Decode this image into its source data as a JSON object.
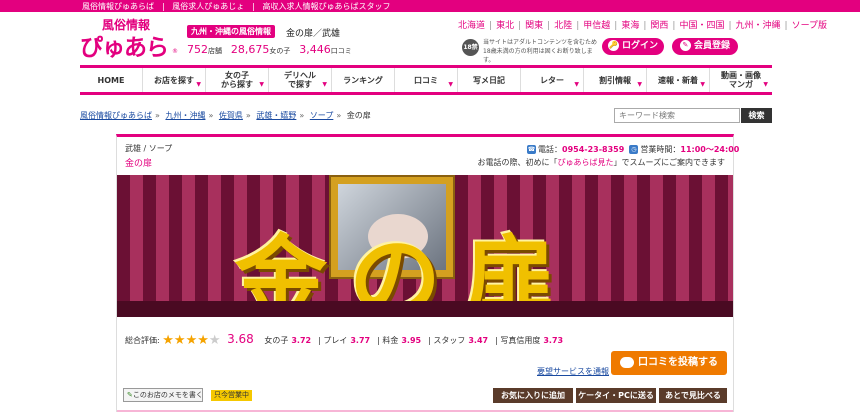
{
  "topbar": {
    "links": [
      "風俗情報ぴゅあらば",
      "風俗求人ぴゅあじょ",
      "高収入求人情報ぴゅあらばスタッフ"
    ]
  },
  "logo": {
    "small": "風俗情報",
    "big": "ぴゅあらば",
    "reg": "®"
  },
  "header": {
    "region_badge": "九州・沖縄の風俗情報",
    "title": "金の扉／武雄",
    "stats": [
      {
        "num": "752",
        "unit": "店舗"
      },
      {
        "num": "28,675",
        "unit": "女の子"
      },
      {
        "num": "3,446",
        "unit": "口コミ"
      }
    ],
    "regions": [
      "北海道",
      "東北",
      "関東",
      "北陸",
      "甲信越",
      "東海",
      "関西",
      "中国・四国",
      "九州・沖縄",
      "ソープ版"
    ],
    "adult_icon": "18禁",
    "adult_note": "当サイトはアダルトコンテンツを含むため18歳未満の方の利用は固くお断り致します。",
    "login_label": "ログイン",
    "register_label": "会員登録"
  },
  "nav": {
    "items": [
      {
        "label": "HOME",
        "caret": false
      },
      {
        "label": "お店を探す",
        "caret": true
      },
      {
        "label": "女の子\nから探す",
        "caret": true
      },
      {
        "label": "デリヘル\nで探す",
        "caret": true
      },
      {
        "label": "ランキング",
        "caret": false
      },
      {
        "label": "口コミ",
        "caret": true
      },
      {
        "label": "写メ日記",
        "caret": false
      },
      {
        "label": "レター",
        "caret": true
      },
      {
        "label": "割引情報",
        "caret": true
      },
      {
        "label": "速報・新着",
        "caret": true
      },
      {
        "label": "動画・画像\nマンガ",
        "caret": true
      }
    ]
  },
  "breadcrumb": {
    "items": [
      "風俗情報ぴゅあらば",
      "九州・沖縄",
      "佐賀県",
      "武雄・嬉野",
      "ソープ"
    ],
    "current": "金の扉"
  },
  "search": {
    "placeholder": "キーワード検索",
    "button": "検索"
  },
  "shop": {
    "category": "武雄 / ソープ",
    "name": "金の扉",
    "phone_label": "電話：",
    "phone": "0954-23-8359",
    "hours_label": "営業時間：",
    "hours": "11:00〜24:00",
    "call_note_pre": "お電話の際、初めに「",
    "call_note_hl": "ぴゅあらば見た",
    "call_note_post": "」でスムーズにご案内できます",
    "banner_text": "金の扉"
  },
  "rating": {
    "label": "総合評価:",
    "stars_filled": 4,
    "stars_total": 5,
    "total": "3.68",
    "scores": [
      {
        "label": "女の子",
        "value": "3.72"
      },
      {
        "label": "プレイ",
        "value": "3.77"
      },
      {
        "label": "料金",
        "value": "3.95"
      },
      {
        "label": "スタッフ",
        "value": "3.47"
      },
      {
        "label": "写真信用度",
        "value": "3.73"
      }
    ]
  },
  "actions": {
    "request_link": "要望サービスを通報",
    "post_review": "口コミを投稿する",
    "memo": "このお店のメモを書く",
    "open_badge": "只今営業中",
    "favorite": "お気に入りに追加",
    "send_mobile": "ケータイ・PCに送る",
    "later": "あとで見比べる"
  },
  "colors": {
    "brand": "#e3007f",
    "orange": "#ef7a00",
    "brown": "#5a3b2a"
  }
}
